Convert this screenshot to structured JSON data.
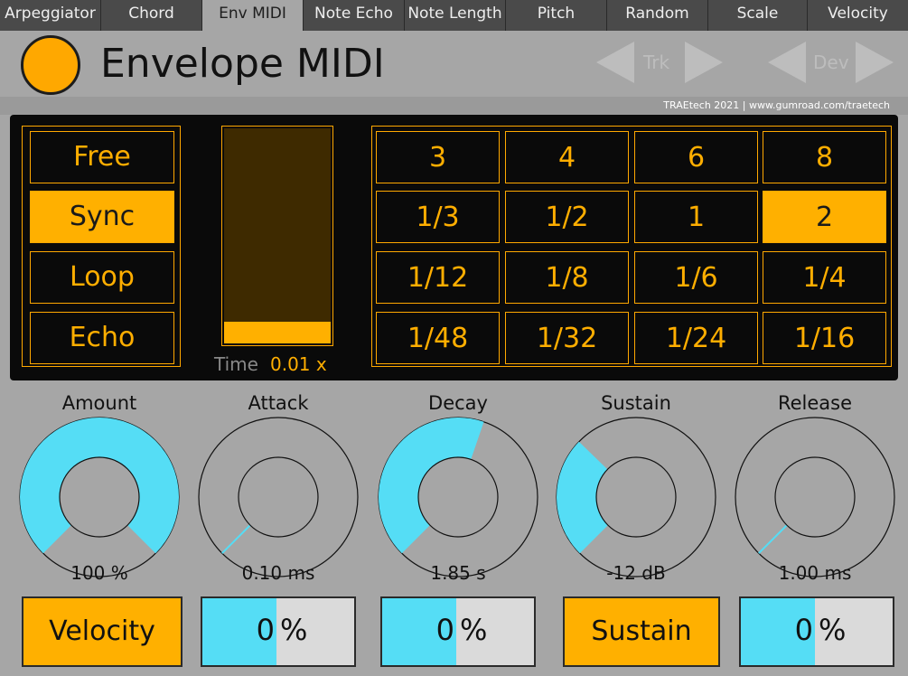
{
  "tabs": [
    "Arpeggiator",
    "Chord",
    "Env MIDI",
    "Note Echo",
    "Note Length",
    "Pitch",
    "Random",
    "Scale",
    "Velocity"
  ],
  "active_tab": "Env MIDI",
  "header": {
    "title": "Envelope MIDI",
    "trk_label": "Trk",
    "dev_label": "Dev",
    "credit": "TRAEtech 2021  |  www.gumroad.com/traetech"
  },
  "modes": [
    {
      "label": "Free",
      "active": false
    },
    {
      "label": "Sync",
      "active": true
    },
    {
      "label": "Loop",
      "active": false
    },
    {
      "label": "Echo",
      "active": false
    }
  ],
  "time": {
    "label": "Time",
    "value": "0.01 x",
    "level": 0.1
  },
  "rate_grid": [
    [
      "3",
      "4",
      "6",
      "8"
    ],
    [
      "1/3",
      "1/2",
      "1",
      "2"
    ],
    [
      "1/12",
      "1/8",
      "1/6",
      "1/4"
    ],
    [
      "1/48",
      "1/32",
      "1/24",
      "1/16"
    ]
  ],
  "rate_selected": "2",
  "knobs": [
    {
      "label": "Amount",
      "value": "100 %",
      "level": 1.0
    },
    {
      "label": "Attack",
      "value": "0.10 ms",
      "level": 0.0
    },
    {
      "label": "Decay",
      "value": "1.85 s",
      "level": 0.57
    },
    {
      "label": "Sustain",
      "value": "-12 dB",
      "level": 0.33
    },
    {
      "label": "Release",
      "value": "1.00 ms",
      "level": 0.0
    }
  ],
  "bottom": {
    "velocity_label": "Velocity",
    "sustain_label": "Sustain",
    "pct1": "0",
    "pct2": "0",
    "pct3": "0",
    "pct_unit": "%"
  },
  "colors": {
    "accent": "#ffb000",
    "knob_fill": "#55ddf5"
  }
}
